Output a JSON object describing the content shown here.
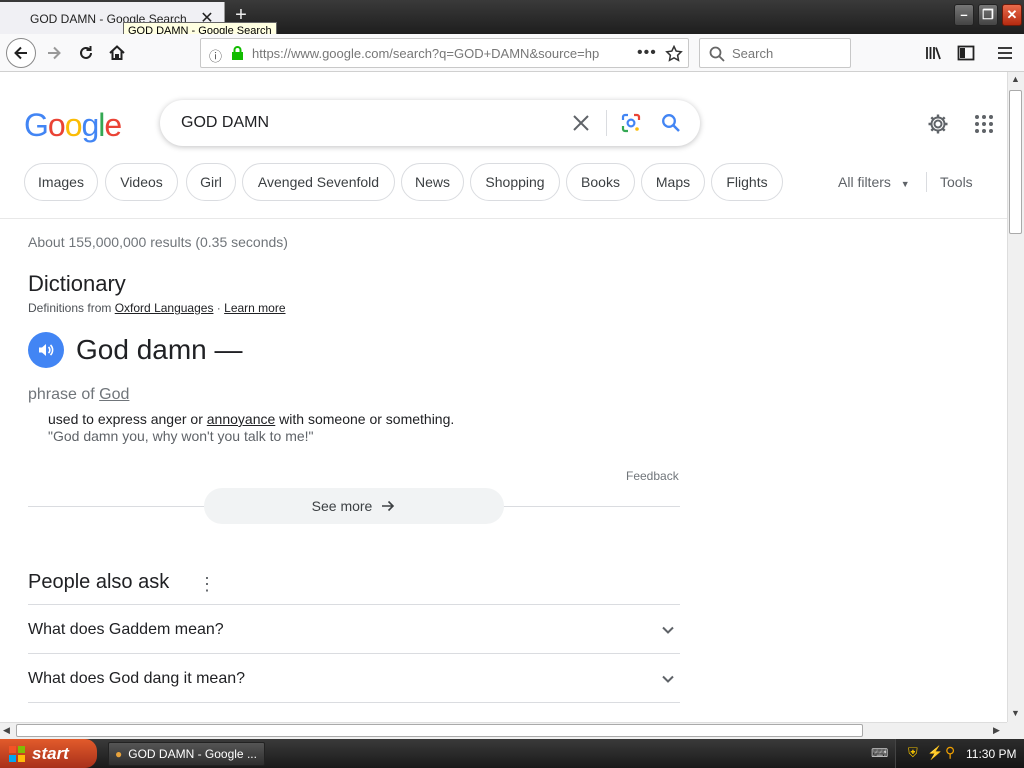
{
  "browser": {
    "tab_title": "GOD DAMN - Google Search",
    "tooltip": "GOD DAMN - Google Search",
    "url": "https://www.google.com/search?q=GOD+DAMN&source=hp",
    "search_placeholder": "Search"
  },
  "google": {
    "logo": [
      "G",
      "o",
      "o",
      "g",
      "l",
      "e"
    ],
    "logo_colors": [
      "#4285f4",
      "#ea4335",
      "#fbbc05",
      "#4285f4",
      "#34a853",
      "#ea4335"
    ],
    "query": "GOD DAMN",
    "chips": [
      "Images",
      "Videos",
      "Girl",
      "Avenged Sevenfold",
      "News",
      "Shopping",
      "Books",
      "Maps",
      "Flights"
    ],
    "all_filters": "All filters",
    "tools": "Tools",
    "stats": "About 155,000,000 results (0.35 seconds)"
  },
  "dictionary": {
    "title": "Dictionary",
    "source_prefix": "Definitions from",
    "source_link": "Oxford Languages",
    "source_sep": " · ",
    "learn_more": "Learn more",
    "word": "God damn —",
    "pos_prefix": "phrase of ",
    "pos_link": "God",
    "def_pre": "used to express anger or ",
    "def_link": "annoyance",
    "def_post": " with someone or something.",
    "example": "\"God damn you, why won't you talk to me!\"",
    "feedback": "Feedback",
    "see_more": "See more"
  },
  "paa": {
    "title": "People also ask",
    "questions": [
      "What does Gaddem mean?",
      "What does God dang it mean?"
    ]
  },
  "taskbar": {
    "start": "start",
    "task": "GOD DAMN - Google ...",
    "clock": "11:30 PM"
  }
}
